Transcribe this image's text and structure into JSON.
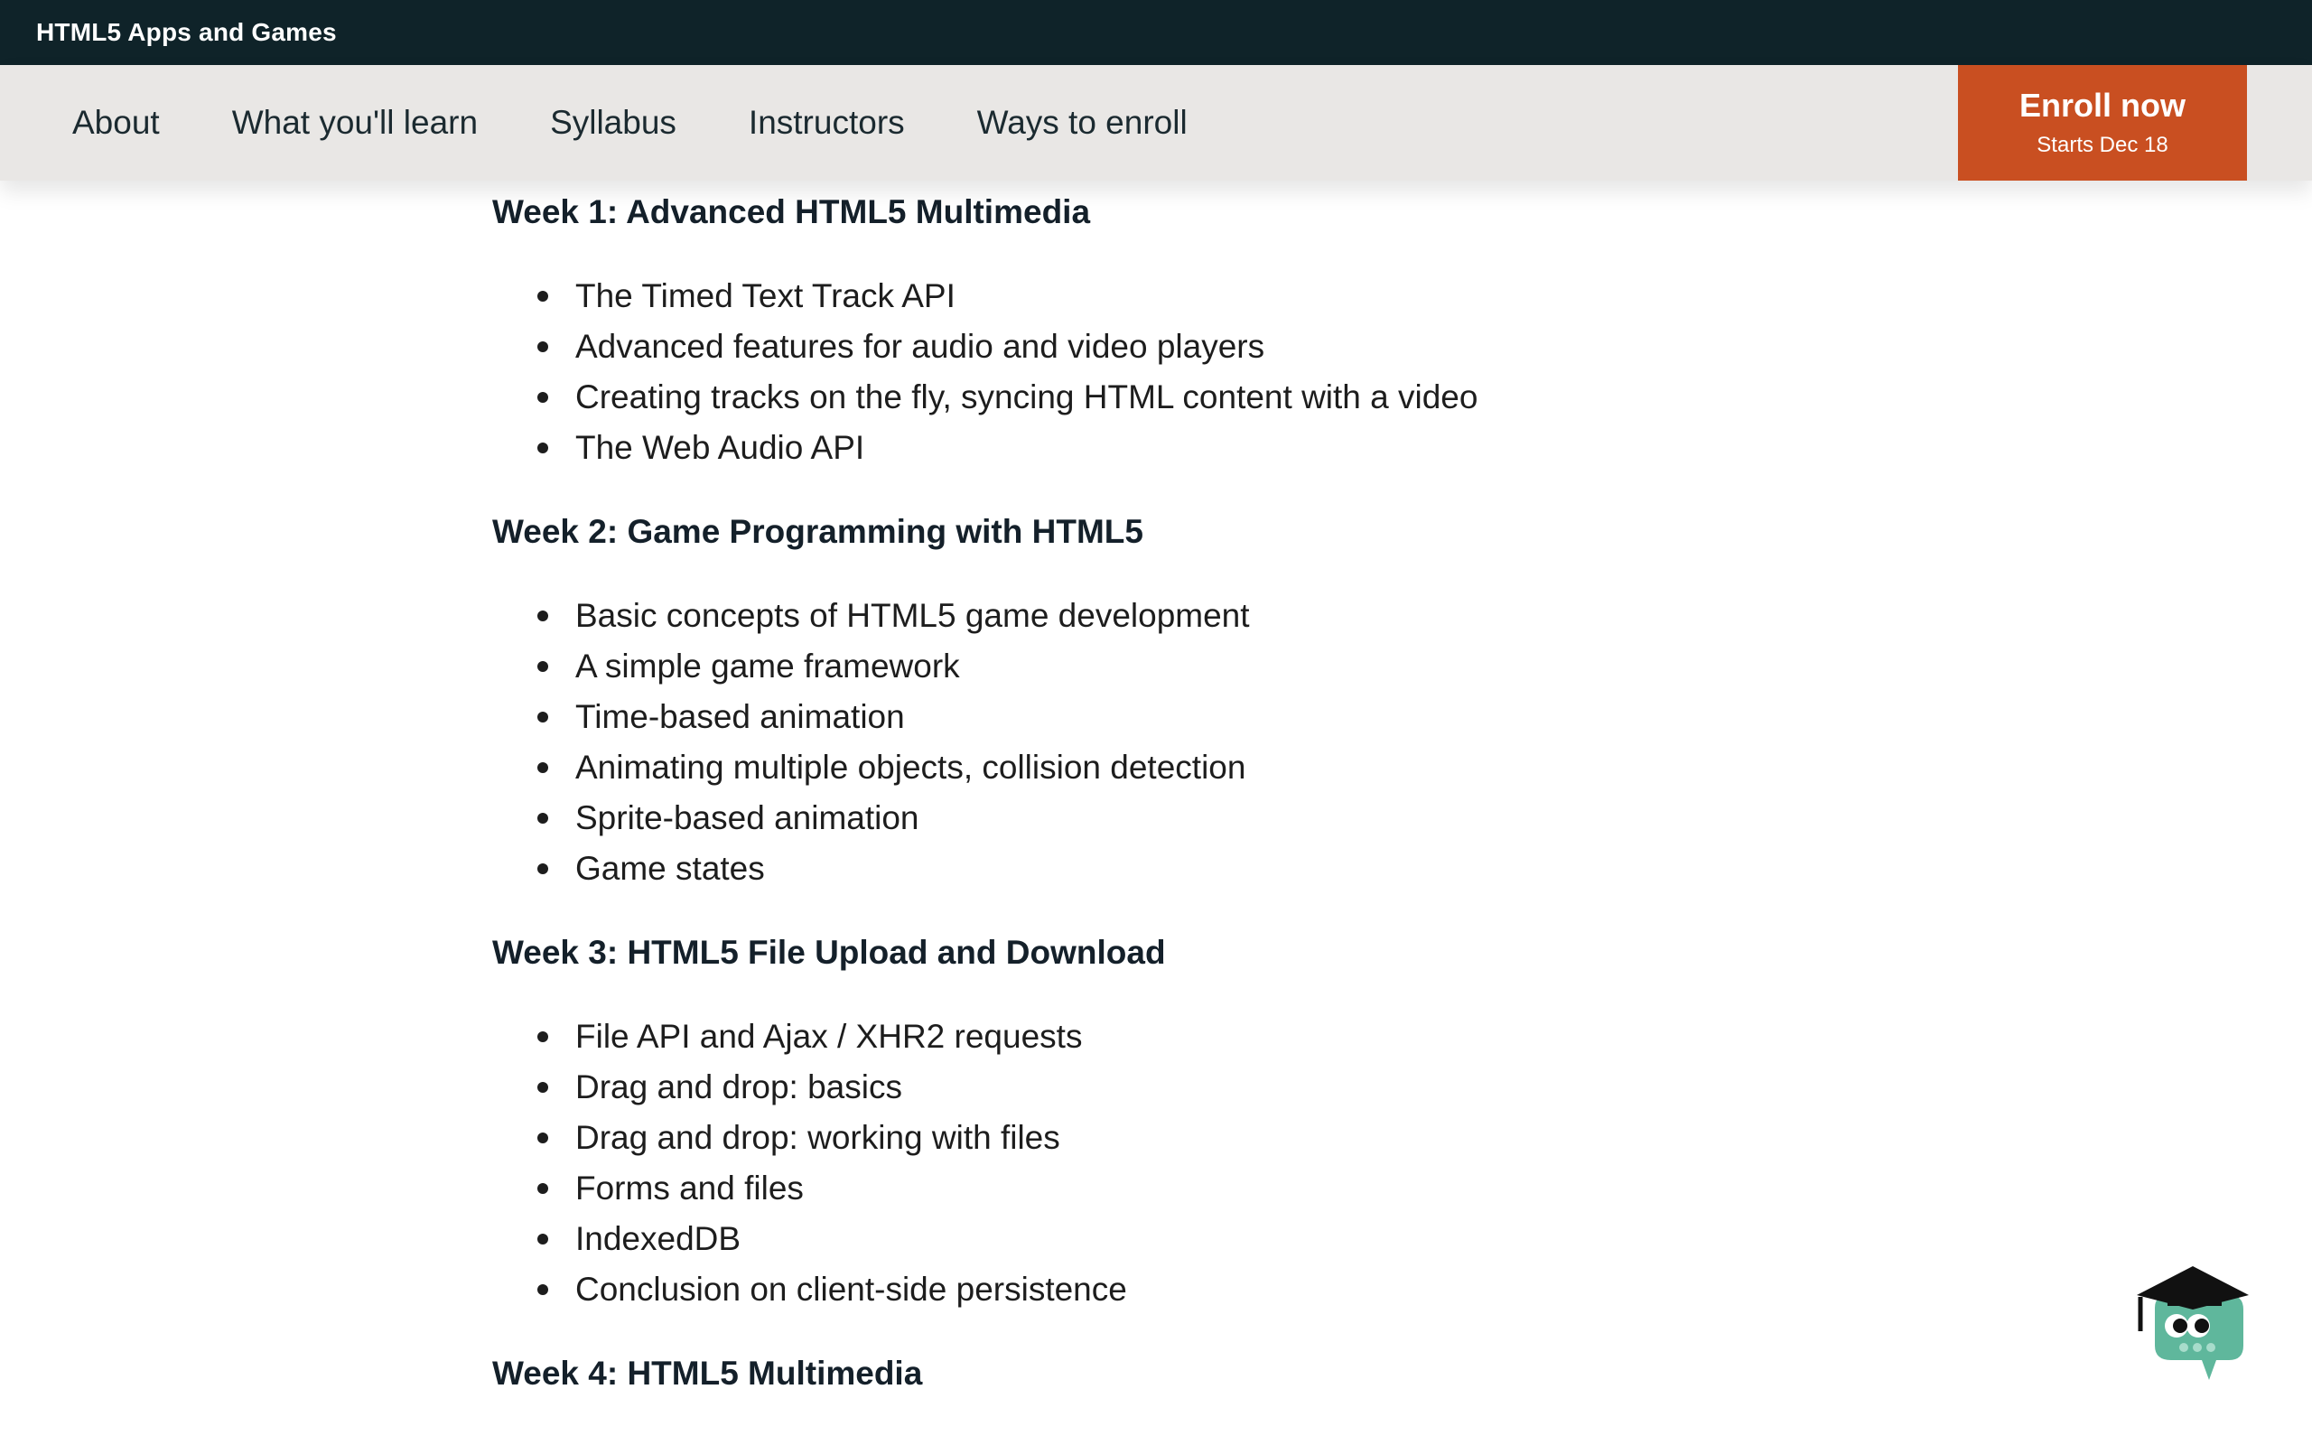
{
  "topbar": {
    "course_title": "HTML5 Apps and Games"
  },
  "nav": {
    "links": [
      "About",
      "What you'll learn",
      "Syllabus",
      "Instructors",
      "Ways to enroll"
    ],
    "enroll_label": "Enroll now",
    "enroll_sub": "Starts Dec 18"
  },
  "syllabus": {
    "weeks": [
      {
        "title": "Week 1: Advanced HTML5 Multimedia",
        "items": [
          "The Timed Text Track API",
          "Advanced features for audio and video players",
          "Creating tracks on the fly, syncing HTML content with a video",
          "The Web Audio API"
        ]
      },
      {
        "title": "Week 2: Game Programming with HTML5",
        "items": [
          "Basic concepts of HTML5 game development",
          "A simple game framework",
          "Time-based animation",
          "Animating multiple objects, collision detection",
          "Sprite-based animation",
          "Game states"
        ]
      },
      {
        "title": "Week 3: HTML5 File Upload and Download",
        "items": [
          "File API and Ajax / XHR2 requests",
          "Drag and drop: basics",
          "Drag and drop: working with files",
          "Forms and files",
          "IndexedDB",
          "Conclusion on client-side persistence"
        ]
      },
      {
        "title": "Week 4: HTML5 Multimedia",
        "items": []
      }
    ]
  },
  "colors": {
    "topbar_bg": "#0f2329",
    "navbar_bg": "#e9e7e5",
    "enroll_bg": "#c94f21",
    "mascot_body": "#5fb79c"
  },
  "icons": {
    "mascot": "graduation-cap-owl-chat-icon"
  }
}
